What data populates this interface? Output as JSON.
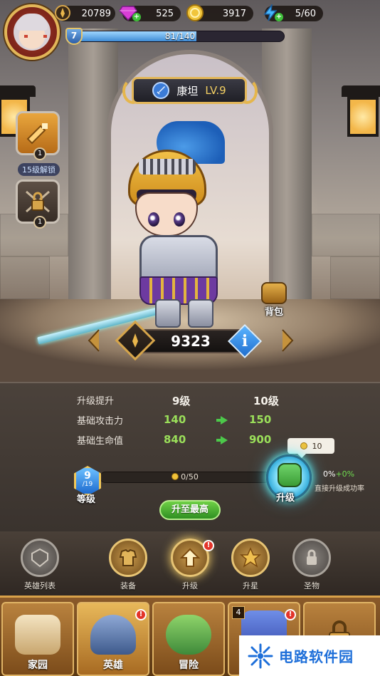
{
  "colors": {
    "gold_accent": "#e2b659",
    "green_stat": "#9be05a",
    "xp_blue": "#3e8cd6",
    "alert_red": "#e3342a",
    "watermark_blue": "#1e6fd9"
  },
  "hud": {
    "power": "20789",
    "gems": "525",
    "gold": "3917",
    "energy": "5/60",
    "player_level": "7",
    "xp_text": "81/140",
    "xp_fraction": 0.578
  },
  "hero": {
    "name": "康坦",
    "level_text": "LV.9",
    "combat_power": "9323",
    "backpack_label": "背包",
    "unlock_tip": "15级解锁",
    "slot1_badge": "1",
    "slot2_badge": "1"
  },
  "upgrade": {
    "header_label": "升级提升",
    "current_level": "9级",
    "next_level": "10级",
    "stats": [
      {
        "label": "基础攻击力",
        "current": "140",
        "next": "150"
      },
      {
        "label": "基础生命值",
        "current": "840",
        "next": "900"
      }
    ],
    "level_num": "9",
    "level_den": "/19",
    "level_caption": "等级",
    "progress_text": "0/50",
    "progress_fraction": 0,
    "cost": "10",
    "upgrade_label": "升级",
    "rate_base": "0%",
    "rate_bonus": "+0%",
    "rate_caption": "直接升级成功率",
    "max_button": "升至最高"
  },
  "subtabs": [
    {
      "label": "英雄列表",
      "icon": "crest-icon"
    },
    {
      "label": "装备",
      "icon": "armor-icon"
    },
    {
      "label": "升级",
      "icon": "upgrade-arrow-icon"
    },
    {
      "label": "升星",
      "icon": "star-icon"
    },
    {
      "label": "圣物",
      "icon": "relic-lock-icon"
    }
  ],
  "bottomnav": [
    {
      "label": "家园",
      "icon": "castle-icon"
    },
    {
      "label": "英雄",
      "icon": "knight-helmet-icon"
    },
    {
      "label": "冒险",
      "icon": "sword-island-icon"
    },
    {
      "label": "",
      "icon": "event-banner-icon",
      "count": "4"
    },
    {
      "label": "",
      "icon": "lock-icon"
    }
  ],
  "watermark": {
    "text": "电路软件园"
  }
}
